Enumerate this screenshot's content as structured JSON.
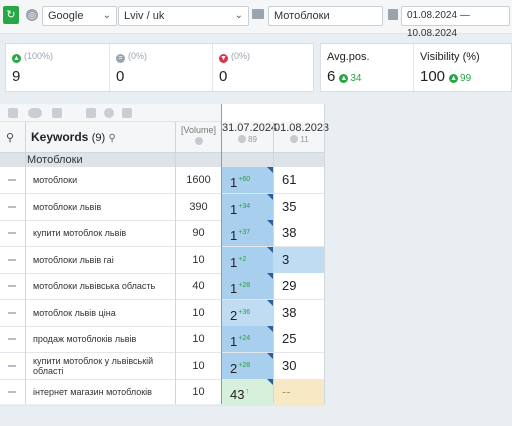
{
  "toolbar": {
    "search_engine": "Google",
    "region": "Lviv / uk",
    "project": "Мотоблоки",
    "date_range": "01.08.2024 — 10.08.2024"
  },
  "cards": {
    "up": {
      "pct": "(100%)",
      "value": "9"
    },
    "same": {
      "pct": "(0%)",
      "value": "0"
    },
    "down": {
      "pct": "(0%)",
      "value": "0"
    },
    "avg_pos": {
      "label": "Avg.pos.",
      "value": "6",
      "delta": "34"
    },
    "visibility": {
      "label": "Visibility (%)",
      "value": "100",
      "delta": "99"
    }
  },
  "table": {
    "keywords_label": "Keywords",
    "keywords_count": "(9)",
    "volume_label": "[Volume]",
    "date1": "31.07.2024",
    "date1_sub": "89",
    "date2": "01.08.2023",
    "date2_sub": "11",
    "group": "Мотоблоки",
    "rows": [
      {
        "kw": "мотоблоки",
        "vol": "1600",
        "p1": "1",
        "d1": "+60",
        "p2": "61"
      },
      {
        "kw": "мотоблоки львів",
        "vol": "390",
        "p1": "1",
        "d1": "+34",
        "p2": "35"
      },
      {
        "kw": "купити мотоблок львів",
        "vol": "90",
        "p1": "1",
        "d1": "+37",
        "p2": "38"
      },
      {
        "kw": "мотоблоки львів гаі",
        "vol": "10",
        "p1": "1",
        "d1": "+2",
        "p2": "3"
      },
      {
        "kw": "мотоблоки львівська область",
        "vol": "40",
        "p1": "1",
        "d1": "+28",
        "p2": "29"
      },
      {
        "kw": "мотоблок львів ціна",
        "vol": "10",
        "p1": "2",
        "d1": "+36",
        "p2": "38"
      },
      {
        "kw": "продаж мотоблоків львів",
        "vol": "10",
        "p1": "1",
        "d1": "+24",
        "p2": "25"
      },
      {
        "kw": "купити мотоблок у львівській області",
        "vol": "10",
        "p1": "2",
        "d1": "+28",
        "p2": "30"
      },
      {
        "kw": "інтернет магазин мотоблоків",
        "vol": "10",
        "p1": "43",
        "d1": "↑",
        "p2": "--"
      }
    ]
  },
  "colors": {
    "accent_green": "#27a745",
    "cell_blue": "#a8d0ee",
    "cell_green": "#d6f0dc",
    "cell_yellow": "#f6e9c3"
  }
}
